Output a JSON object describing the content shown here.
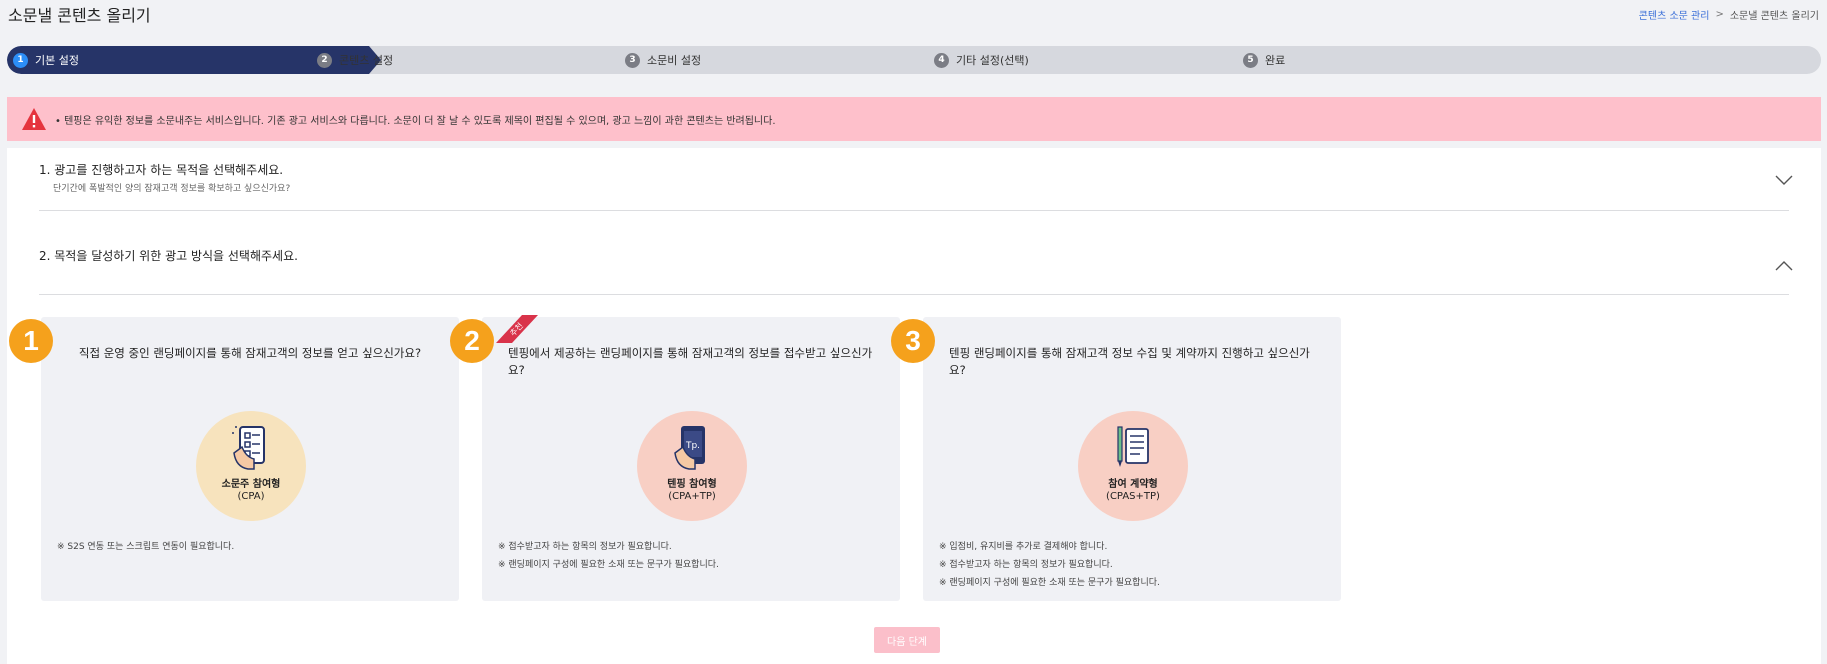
{
  "header": {
    "title": "소문낼 콘텐츠 올리기",
    "breadcrumb": {
      "link": "콘텐츠 소문 관리",
      "separator": ">",
      "current": "소문낼 콘텐츠 올리기"
    }
  },
  "steps": [
    {
      "num": "1",
      "label": "기본 설정",
      "active": true
    },
    {
      "num": "2",
      "label": "콘텐츠 설정"
    },
    {
      "num": "3",
      "label": "소문비 설정"
    },
    {
      "num": "4",
      "label": "기타 설정(선택)"
    },
    {
      "num": "5",
      "label": "완료"
    }
  ],
  "alert": {
    "icon": "warning-icon",
    "text": "• 텐핑은 유익한 정보를 소문내주는 서비스입니다. 기존 광고 서비스와 다릅니다. 소문이 더 잘 날 수 있도록 제목이 편집될 수 있으며, 광고 느낌이 과한 콘텐츠는 반려됩니다."
  },
  "questions": {
    "q1": {
      "title": "1. 광고를 진행하고자 하는 목적을 선택해주세요.",
      "subtitle": "단기간에 폭발적인 양의 잠재고객 정보를 확보하고 싶으신가요?",
      "expanded": false
    },
    "q2": {
      "title": "2. 목적을 달성하기 위한 광고 방식을 선택해주세요.",
      "expanded": true
    }
  },
  "cards": [
    {
      "badge": "1",
      "question": "직접 운영 중인 랜딩페이지를 통해 잠재고객의 정보를 얻고 싶으신가요?",
      "icon": "phone-checklist-icon",
      "label": "소문주 참여형",
      "code": "(CPA)",
      "circle_color": "#f7e3bd",
      "notes": [
        "※ S2S 연동 또는 스크립트 연동이 필요합니다."
      ]
    },
    {
      "badge": "2",
      "ribbon": "추천",
      "question": "텐핑에서 제공하는 랜딩페이지를 통해 잠재고객의 정보를 접수받고 싶으신가요?",
      "icon": "tenping-phone-icon",
      "icon_text": "Tp.",
      "label": "텐핑 참여형",
      "code": "(CPA+TP)",
      "circle_color": "#f8cfc4",
      "notes": [
        "※ 접수받고자 하는 항목의 정보가 필요합니다.",
        "※ 랜딩페이지 구성에 필요한 소재 또는 문구가 필요합니다."
      ]
    },
    {
      "badge": "3",
      "question": "텐핑 랜딩페이지를 통해 잠재고객 정보 수집 및 계약까지 진행하고 싶으신가요?",
      "icon": "contract-pen-icon",
      "label": "참여 계약형",
      "code": "(CPAS+TP)",
      "circle_color": "#f8cfc4",
      "notes": [
        "※ 입점비, 유지비를 추가로 결제해야 합니다.",
        "※ 접수받고자 하는 항목의 정보가 필요합니다.",
        "※ 랜딩페이지 구성에 필요한 소재 또는 문구가 필요합니다."
      ]
    }
  ],
  "next_button": "다음 단계",
  "colors": {
    "primary_dark": "#263468",
    "step_active_num": "#2c8ef8",
    "badge": "#f5a11c",
    "alert_bg": "#fec0cb",
    "ribbon": "#d9334a"
  }
}
